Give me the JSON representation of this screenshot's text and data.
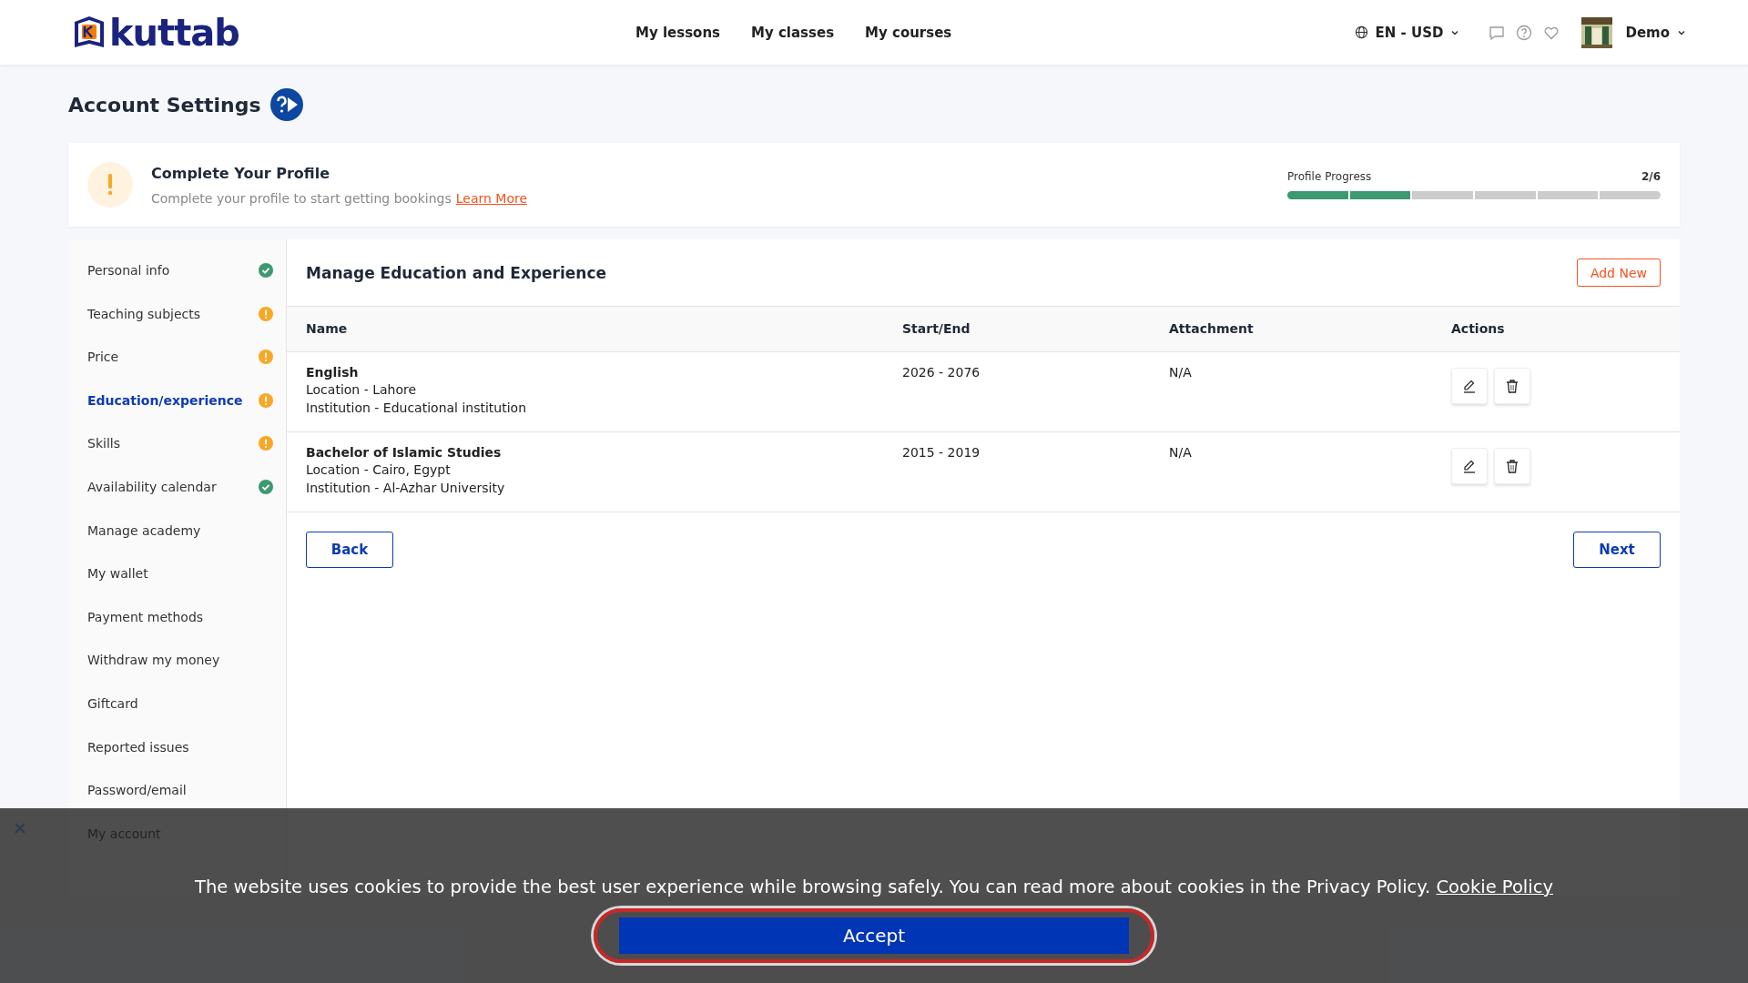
{
  "header": {
    "logo": "kuttab",
    "nav": [
      "My lessons",
      "My classes",
      "My courses"
    ],
    "locale": "EN - USD",
    "user": "Demo"
  },
  "page": {
    "title": "Account Settings"
  },
  "profile_card": {
    "title": "Complete Your Profile",
    "text": "Complete your profile to start getting bookings",
    "link": "Learn More",
    "progress_label": "Profile Progress",
    "progress_count": "2/6",
    "segments": [
      {
        "filled": true
      },
      {
        "filled": true
      },
      {
        "filled": false
      },
      {
        "filled": false
      },
      {
        "filled": false
      },
      {
        "filled": false
      }
    ]
  },
  "sidebar": {
    "items": [
      {
        "label": "Personal info",
        "kind": "complete",
        "selected": false
      },
      {
        "label": "Teaching subjects",
        "kind": "incomplete",
        "selected": false
      },
      {
        "label": "Price",
        "kind": "incomplete",
        "selected": false
      },
      {
        "label": "Education/experience",
        "kind": "incomplete",
        "selected": true
      },
      {
        "label": "Skills",
        "kind": "incomplete",
        "selected": false
      },
      {
        "label": "Availability calendar",
        "kind": "complete",
        "selected": false
      },
      {
        "label": "Manage academy",
        "kind": "plain",
        "selected": false
      },
      {
        "label": "My wallet",
        "kind": "plain",
        "selected": false
      },
      {
        "label": "Payment methods",
        "kind": "plain",
        "selected": false
      },
      {
        "label": "Withdraw my money",
        "kind": "plain",
        "selected": false
      },
      {
        "label": "Giftcard",
        "kind": "plain",
        "selected": false
      },
      {
        "label": "Reported issues",
        "kind": "plain",
        "selected": false
      },
      {
        "label": "Password/email",
        "kind": "plain",
        "selected": false
      },
      {
        "label": "My account",
        "kind": "plain",
        "selected": false
      }
    ]
  },
  "main": {
    "title": "Manage Education and Experience",
    "add_button": "Add New",
    "table": {
      "columns": [
        "Name",
        "Start/End",
        "Attachment",
        "Actions"
      ],
      "rows": [
        {
          "name": "English",
          "location": "Location - Lahore",
          "institution": "Institution - Educational institution",
          "period": "2026 - 2076",
          "attachment": "N/A"
        },
        {
          "name": "Bachelor of Islamic Studies",
          "location": "Location - Cairo, Egypt",
          "institution": "Institution - Al-Azhar University",
          "period": "2015 - 2019",
          "attachment": "N/A"
        }
      ]
    },
    "back_button": "Back",
    "next_button": "Next"
  },
  "cookie_banner": {
    "text": "The website uses cookies to provide the best user experience while browsing safely. You can read more about cookies in the Privacy Policy.",
    "link": "Cookie Policy",
    "accept": "Accept"
  }
}
